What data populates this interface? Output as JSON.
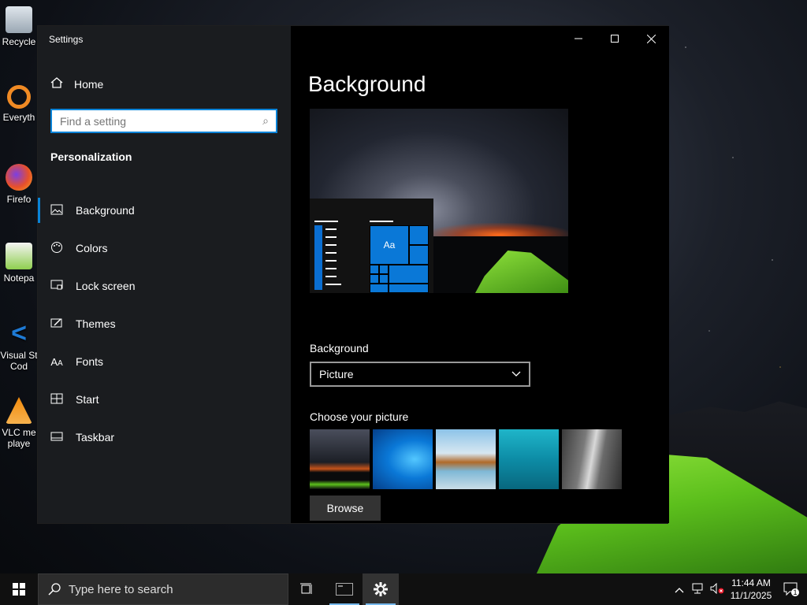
{
  "desktop": {
    "icons": [
      {
        "label": "Recycle",
        "color": "#c9d3dc"
      },
      {
        "label": "Everyth",
        "color": "#f08a24"
      },
      {
        "label": "Firefo",
        "color": "#e8502a"
      },
      {
        "label": "Notepa",
        "color": "#7bc043"
      },
      {
        "label": "Visual St Cod",
        "color": "#1e7ad4"
      },
      {
        "label": "VLC me playe",
        "color": "#f28a0c"
      }
    ]
  },
  "settings": {
    "window_title": "Settings",
    "home_label": "Home",
    "search_placeholder": "Find a setting",
    "section_title": "Personalization",
    "nav": [
      {
        "label": "Background",
        "icon": "picture-icon",
        "active": true
      },
      {
        "label": "Colors",
        "icon": "palette-icon"
      },
      {
        "label": "Lock screen",
        "icon": "lock-screen-icon"
      },
      {
        "label": "Themes",
        "icon": "themes-icon"
      },
      {
        "label": "Fonts",
        "icon": "fonts-icon"
      },
      {
        "label": "Start",
        "icon": "start-icon"
      },
      {
        "label": "Taskbar",
        "icon": "taskbar-icon"
      }
    ],
    "page_title": "Background",
    "preview_tile_text": "Aa",
    "background_label": "Background",
    "background_value": "Picture",
    "choose_label": "Choose your picture",
    "browse_label": "Browse",
    "accent_color": "#0a78d7"
  },
  "taskbar": {
    "search_placeholder": "Type here to search",
    "time": "11:44 AM",
    "date": "11/1/2025",
    "notification_count": "1"
  }
}
